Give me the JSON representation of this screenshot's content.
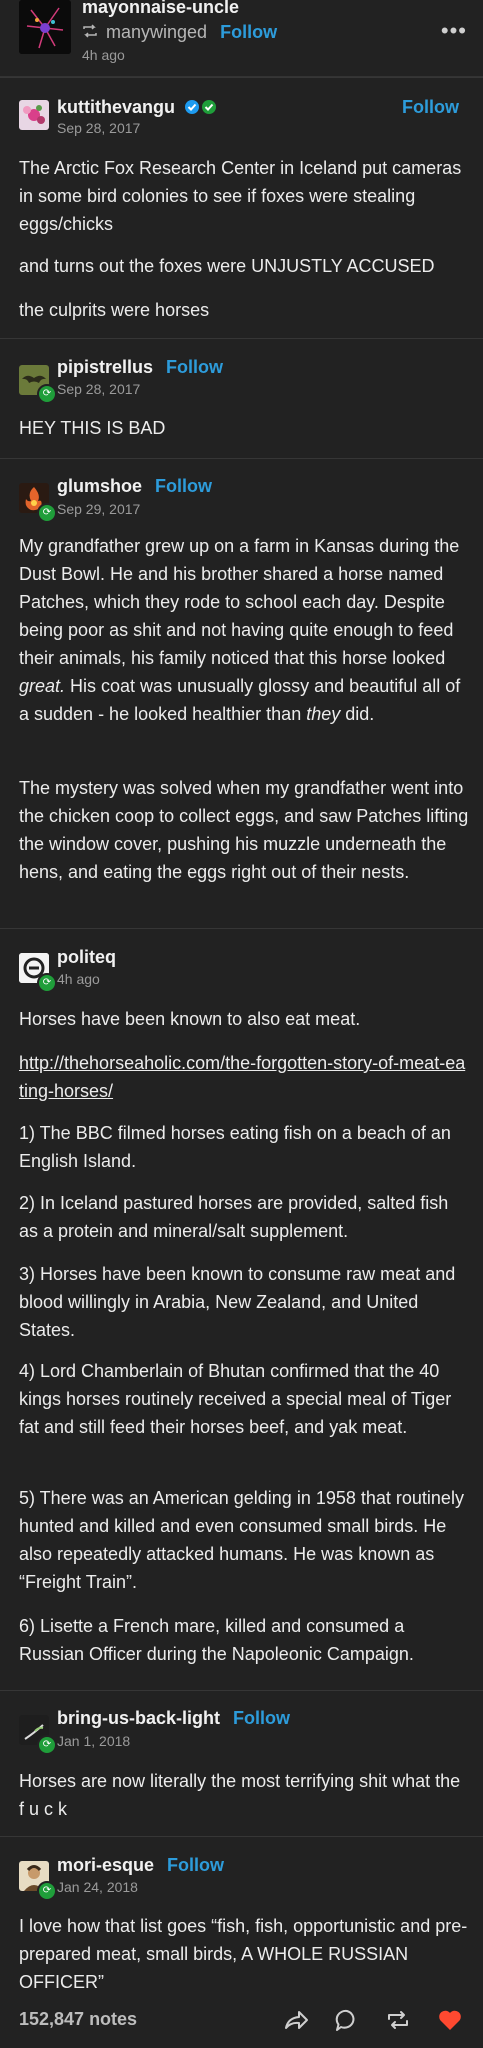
{
  "header": {
    "username": "mayonnaise-uncle",
    "reblogged_from": "manywinged",
    "follow_label": "Follow",
    "time": "4h ago",
    "more_label": "•••"
  },
  "posts": [
    {
      "username": "kuttithevangu",
      "follow_label": "Follow",
      "date": "Sep 28, 2017",
      "paragraphs": [
        "The Arctic Fox Research Center in Iceland put cameras in some bird colonies to see if foxes were stealing eggs/chicks",
        "and turns out the foxes were UNJUSTLY ACCUSED",
        "the culprits were horses"
      ]
    },
    {
      "username": "pipistrellus",
      "follow_label": "Follow",
      "date": "Sep 28, 2017",
      "paragraphs": [
        "HEY THIS IS BAD"
      ]
    },
    {
      "username": "glumshoe",
      "follow_label": "Follow",
      "date": "Sep 29, 2017",
      "p1_a": "My grandfather grew up on a farm in Kansas during the Dust Bowl. He and his brother shared a horse named Patches, which they rode to school each day. Despite being poor as shit and not having quite enough to feed their animals, his family noticed that this horse looked ",
      "p1_em1": "great.",
      "p1_b": " His coat was unusually glossy and beautiful all of a sudden - he looked healthier than ",
      "p1_em2": "they",
      "p1_c": " did.",
      "p2": "The mystery was solved when my grandfather went into the chicken coop to collect eggs, and saw Patches lifting the window cover, pushing his muzzle underneath the hens, and eating the eggs right out of their nests."
    },
    {
      "username": "politeq",
      "date": "4h ago",
      "intro": "Horses have been known to also eat meat.",
      "link": "http://thehorseaholic.com/the-forgotten-story-of-meat-eating-horses/",
      "items": [
        "1) The BBC filmed horses eating fish on a beach of an English Island.",
        "2) In Iceland pastured horses are provided, salted fish as a protein and mineral/salt supplement.",
        "3) Horses have been known to consume raw meat and blood willingly in Arabia, New Zealand, and United States.",
        "4) Lord Chamberlain of Bhutan confirmed that the 40 kings horses routinely received a special meal of Tiger fat and still feed their horses beef, and yak meat.",
        "5) There was an American gelding in 1958 that routinely hunted and killed and even consumed small birds. He also repeatedly attacked   humans. He was known as “Freight Train”.",
        "6) Lisette a French mare, killed and consumed a Russian Officer during the Napoleonic Campaign."
      ]
    },
    {
      "username": "bring-us-back-light",
      "follow_label": "Follow",
      "date": "Jan 1, 2018",
      "paragraphs": [
        "Horses are now literally the most terrifying shit what the f u c k"
      ]
    },
    {
      "username": "mori-esque",
      "follow_label": "Follow",
      "date": "Jan 24, 2018",
      "paragraphs": [
        "I love how that list goes “fish, fish, opportunistic and pre-prepared meat, small birds, A WHOLE RUSSIAN OFFICER”"
      ]
    }
  ],
  "footer": {
    "notes": "152,847 notes"
  },
  "colors": {
    "background": "#222222",
    "follow": "#2d9cdb",
    "badge": "#1f9e3a",
    "like": "#ff4930"
  },
  "icons": [
    "reblog-icon",
    "more-icon",
    "verified-icon",
    "share-icon",
    "reply-icon",
    "reblog-action-icon",
    "like-icon"
  ]
}
